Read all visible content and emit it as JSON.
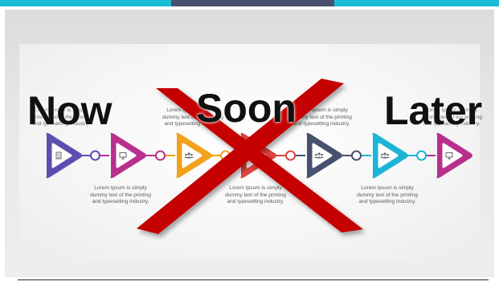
{
  "slide": {
    "captions_top": [
      "Lorem Ipsum is simply dummy text of the printing and typesetting industry.",
      "Lorem Ipsum is simply dummy text of the printing and typesetting industry.",
      "Lorem Ipsum is simply dummy text of the printing and typesetting industry.",
      "Lorem Ipsum is simply dummy text of the printing and typesetting industry."
    ],
    "captions_bottom": [
      "Lorem Ipsum is simply dummy text of the printing and typesetting industry.",
      "Lorem Ipsum is simply dummy text of the printing and typesetting industry.",
      "Lorem Ipsum is simply dummy text of the printing and typesetting industry."
    ],
    "steps": [
      {
        "color": "#5b4fb0",
        "icon": "document-icon"
      },
      {
        "color": "#b8308e",
        "icon": "presentation-icon"
      },
      {
        "color": "#f1a11c",
        "icon": "team-icon"
      },
      {
        "color": "#e0443f",
        "icon": "clock-icon"
      },
      {
        "color": "#47506e",
        "icon": "team-icon"
      },
      {
        "color": "#1cb5d6",
        "icon": "team-icon"
      },
      {
        "color": "#b8308e",
        "icon": "monitor-icon"
      }
    ]
  },
  "overlay": {
    "labels": [
      "Now",
      "Soon",
      "Later"
    ],
    "cross_color": "#c40000"
  },
  "topbar": {
    "colors": [
      "#1bbcd8",
      "#48506d",
      "#1bbcd8"
    ]
  }
}
